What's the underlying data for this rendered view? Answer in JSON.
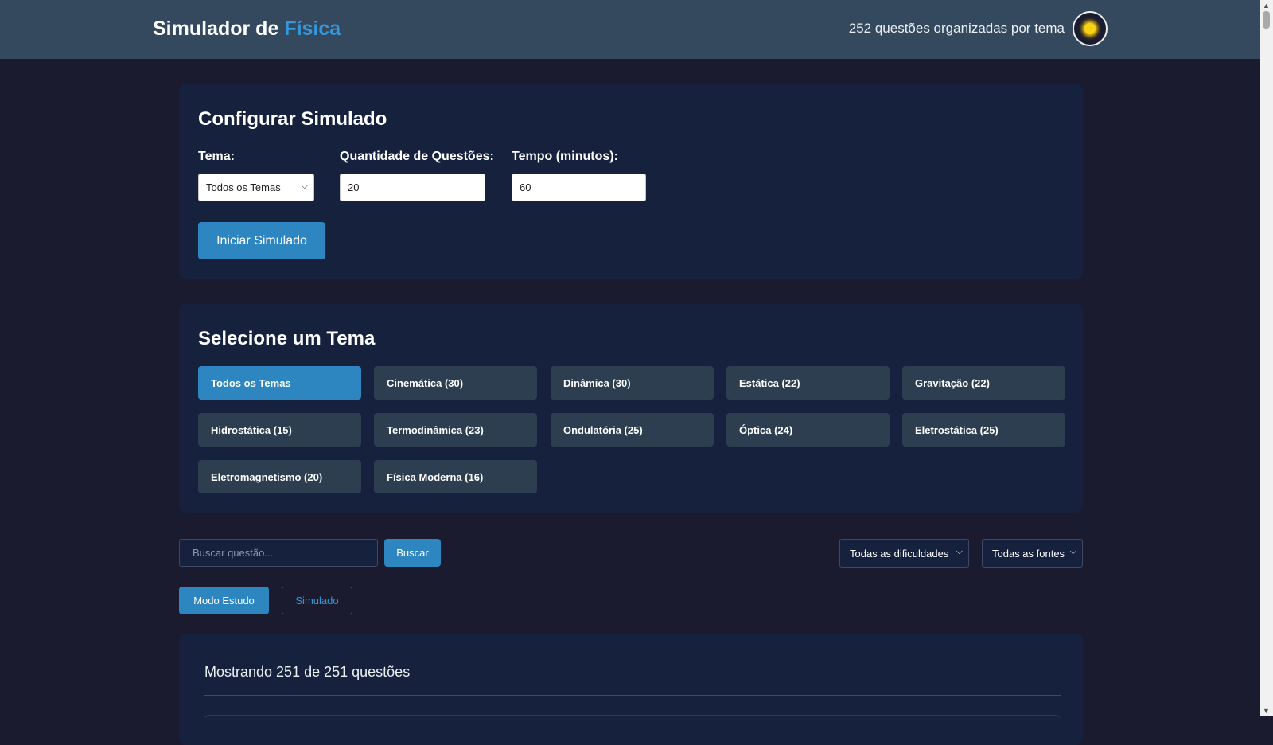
{
  "header": {
    "brand_prefix": "Simulador de ",
    "brand_accent": "Física",
    "question_count": "252 questões organizadas por tema",
    "theme_toggle_icon": "sun-icon"
  },
  "config": {
    "title": "Configurar Simulado",
    "tema_label": "Tema:",
    "tema_value": "Todos os Temas",
    "quantidade_label": "Quantidade de Questões:",
    "quantidade_value": "20",
    "tempo_label": "Tempo (minutos):",
    "tempo_value": "60",
    "start_button": "Iniciar Simulado"
  },
  "themes": {
    "title": "Selecione um Tema",
    "items": [
      {
        "label": "Todos os Temas",
        "active": true
      },
      {
        "label": "Cinemática (30)"
      },
      {
        "label": "Dinâmica (30)"
      },
      {
        "label": "Estática (22)"
      },
      {
        "label": "Gravitação (22)"
      },
      {
        "label": "Hidrostática (15)"
      },
      {
        "label": "Termodinâmica (23)"
      },
      {
        "label": "Ondulatória (25)"
      },
      {
        "label": "Óptica (24)"
      },
      {
        "label": "Eletrostática (25)"
      },
      {
        "label": "Eletromagnetismo (20)"
      },
      {
        "label": "Física Moderna (16)"
      }
    ]
  },
  "toolbar": {
    "search_placeholder": "Buscar questão...",
    "search_button": "Buscar",
    "difficulty_filter": "Todas as dificuldades",
    "source_filter": "Todas as fontes",
    "mode_study": "Modo Estudo",
    "mode_simulado": "Simulado"
  },
  "results": {
    "summary": "Mostrando 251 de 251 questões"
  },
  "colors": {
    "background": "#1b1b2f",
    "header": "#34495e",
    "card": "#16213e",
    "accent": "#2e86c1",
    "theme_button": "#2c3e50"
  }
}
